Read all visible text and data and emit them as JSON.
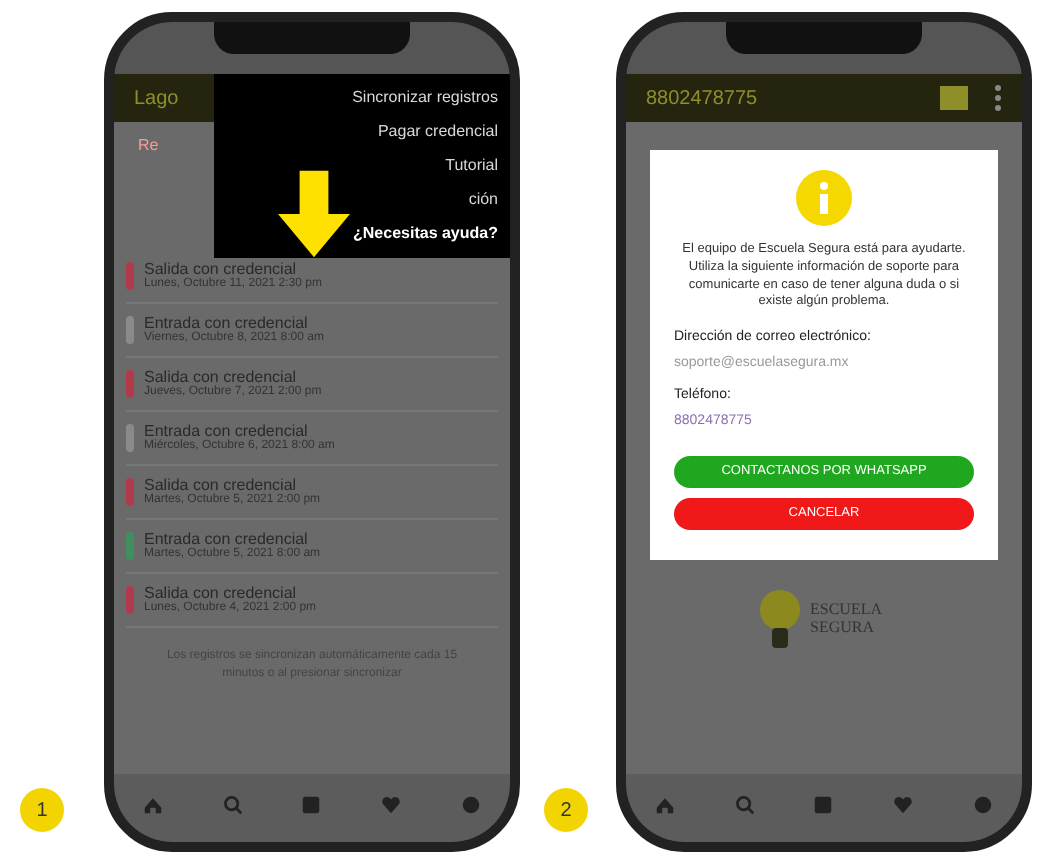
{
  "screens": [
    {
      "step": "1",
      "header_title": "Lago",
      "section_label": "Re",
      "menu": {
        "items": [
          {
            "label": "Sincronizar registros",
            "selected": false
          },
          {
            "label": "Pagar credencial",
            "selected": false
          },
          {
            "label": "Tutorial",
            "selected": false
          },
          {
            "label": "ción",
            "selected": false
          },
          {
            "label": "¿Necesitas ayuda?",
            "selected": true
          }
        ]
      },
      "records": [
        {
          "title": "Salida con credencial",
          "date": "Lunes, Octubre 11, 2021 2:30 pm",
          "color": "#b03a4a"
        },
        {
          "title": "Entrada con credencial",
          "date": "Viernes, Octubre 8, 2021 8:00 am",
          "color": "#8a8a8a"
        },
        {
          "title": "Salida con credencial",
          "date": "Jueves, Octubre 7, 2021 2:00 pm",
          "color": "#b03a4a"
        },
        {
          "title": "Entrada con credencial",
          "date": "Miércoles, Octubre 6, 2021 8:00 am",
          "color": "#8a8a8a"
        },
        {
          "title": "Salida con credencial",
          "date": "Martes, Octubre 5, 2021 2:00 pm",
          "color": "#b03a4a"
        },
        {
          "title": "Entrada con credencial",
          "date": "Martes, Octubre 5, 2021 8:00 am",
          "color": "#3f8f5f"
        },
        {
          "title": "Salida con credencial",
          "date": "Lunes, Octubre 4, 2021 2:00 pm",
          "color": "#b03a4a"
        }
      ],
      "footer_note": "Los registros se sincronizan automáticamente cada 15 minutos o al presionar sincronizar"
    },
    {
      "step": "2",
      "header_title": "8802478775",
      "dialog": {
        "message": "El equipo de Escuela Segura está para ayudarte. Utiliza la siguiente información de soporte para comunicarte en caso de tener alguna duda o si existe algún problema.",
        "email_label": "Dirección de correo electrónico:",
        "email": "soporte@escuelasegura.mx",
        "phone_label": "Teléfono:",
        "phone": "8802478775",
        "buttons": [
          {
            "label": "CONTACTANOS POR WHATSAPP",
            "kind": "confirm"
          },
          {
            "label": "CANCELAR",
            "kind": "cancel"
          }
        ]
      },
      "logo_text": "ESCUELA SEGURA"
    }
  ]
}
